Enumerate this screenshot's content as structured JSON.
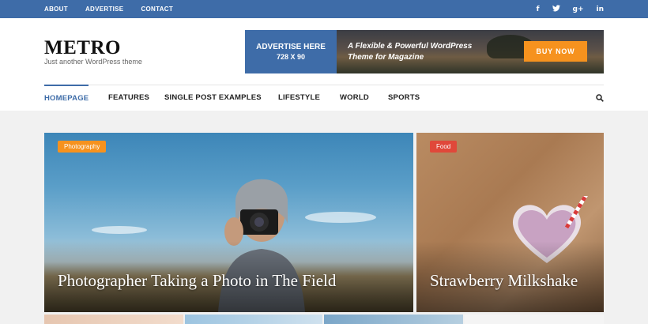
{
  "topbar": {
    "links": [
      "ABOUT",
      "ADVERTISE",
      "CONTACT"
    ],
    "social_icons": [
      "facebook-icon",
      "twitter-icon",
      "google-plus-icon",
      "linkedin-icon"
    ],
    "social_glyphs": [
      "f",
      "t",
      "g+",
      "in"
    ]
  },
  "header": {
    "logo": "METRO",
    "tagline": "Just another WordPress theme"
  },
  "ad": {
    "left_line1": "ADVERTISE HERE",
    "left_line2": "728 X 90",
    "text_line1": "A Flexible & Powerful WordPress",
    "text_line2": "Theme for Magazine",
    "button": "BUY NOW"
  },
  "nav": {
    "items": [
      "HOMEPAGE",
      "FEATURES",
      "SINGLE POST EXAMPLES",
      "LIFESTYLE",
      "WORLD",
      "SPORTS"
    ],
    "active": "HOMEPAGE"
  },
  "cards": [
    {
      "category": "Photography",
      "title": "Photographer Taking a Photo in The Field"
    },
    {
      "category": "Food",
      "title": "Strawberry Milkshake"
    }
  ],
  "colors": {
    "brand": "#3e6ca8",
    "accent_orange": "#f6921e",
    "accent_red": "#e0483a"
  }
}
